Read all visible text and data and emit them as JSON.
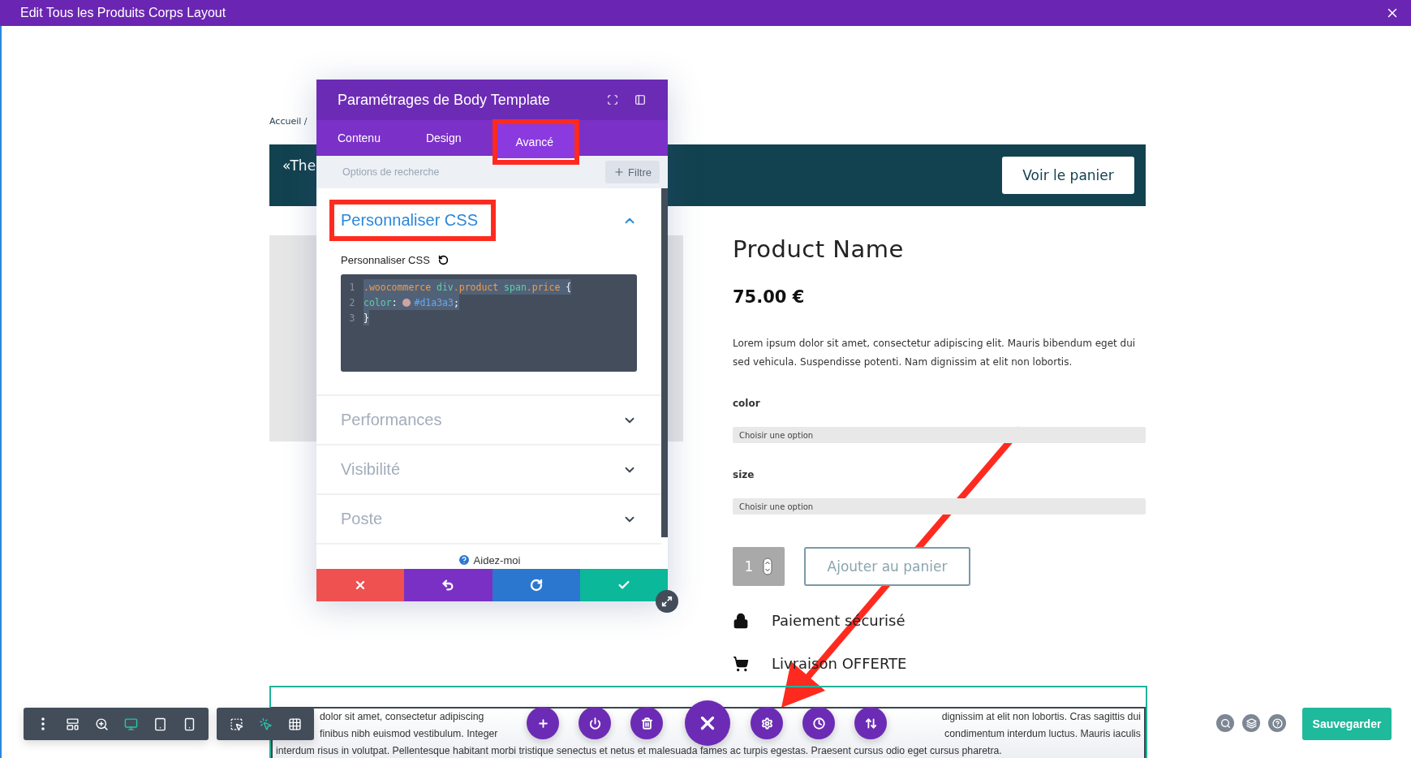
{
  "window": {
    "title": "Edit Tous les Produits Corps Layout"
  },
  "breadcrumb": "Accueil /",
  "banner": {
    "text": "«The",
    "button": "Voir le panier"
  },
  "product": {
    "name": "Product Name",
    "price": "75.00 €",
    "description": "Lorem ipsum dolor sit amet, consectetur adipiscing elit. Mauris bibendum eget dui sed vehicula. Suspendisse potenti. Nam dignissim at elit non lobortis.",
    "attributes": [
      {
        "label": "color",
        "placeholder": "Choisir une option"
      },
      {
        "label": "size",
        "placeholder": "Choisir une option"
      }
    ],
    "quantity": "1",
    "add_button": "Ajouter au panier",
    "features": [
      {
        "kind": "lock",
        "text": "Paiement sécurisé"
      },
      {
        "kind": "cart",
        "text": "Livraison OFFERTE"
      }
    ]
  },
  "description_lines": [
    {
      "segments": [
        "dolor sit amet, consectetur adipiscing",
        "dignissim at elit non lobortis. Cras sagittis dui"
      ]
    },
    {
      "segments": [
        "finibus nibh euismod vestibulum. Integer",
        "condimentum interdum luctus. Mauris iaculis"
      ]
    },
    {
      "segments": [
        "interdum risus in volutpat. Pellentesque habitant morbi tristique senectus et netus et malesuada fames ac turpis egestas. Praesent cursus odio eget cursus pharetra."
      ]
    }
  ],
  "modal": {
    "title": "Paramétrages de Body Template",
    "tabs": [
      {
        "label": "Contenu",
        "selected": false,
        "highlighted": false
      },
      {
        "label": "Design",
        "selected": false,
        "highlighted": false
      },
      {
        "label": "Avancé",
        "selected": true,
        "highlighted": true
      }
    ],
    "search_placeholder": "Options de recherche",
    "filter_button": "Filtre",
    "sections": [
      {
        "title": "Personnaliser CSS",
        "expanded": true,
        "highlighted": true,
        "field_label": "Personnaliser CSS",
        "code": [
          {
            "number": "1",
            "tokens": [
              {
                "kind": "selector",
                "text": ".woocommerce"
              },
              {
                "kind": "tag",
                "text": " div"
              },
              {
                "kind": "selector",
                "text": ".product"
              },
              {
                "kind": "tag",
                "text": " span"
              },
              {
                "kind": "selector",
                "text": ".price"
              },
              {
                "kind": "plain",
                "text": " {"
              }
            ]
          },
          {
            "number": "2",
            "tokens": [
              {
                "kind": "tag",
                "text": "color"
              },
              {
                "kind": "plain",
                "text": ": "
              },
              {
                "kind": "swatch",
                "color": "#d1a3a3"
              },
              {
                "kind": "value",
                "text": "#d1a3a3"
              },
              {
                "kind": "plain",
                "text": ";"
              }
            ]
          },
          {
            "number": "3",
            "tokens": [
              {
                "kind": "plain",
                "text": "}"
              }
            ]
          }
        ]
      },
      {
        "title": "Performances",
        "expanded": false,
        "highlighted": false
      },
      {
        "title": "Visibilité",
        "expanded": false,
        "highlighted": false
      },
      {
        "title": "Poste",
        "expanded": false,
        "highlighted": false
      }
    ],
    "help": "Aidez-moi",
    "actions": [
      {
        "kind": "cancel"
      },
      {
        "kind": "undo"
      },
      {
        "kind": "redo"
      },
      {
        "kind": "save"
      }
    ]
  },
  "toolbar": {
    "groups": [
      [
        {
          "kind": "menu",
          "selected": false
        },
        {
          "kind": "layout",
          "selected": false
        },
        {
          "kind": "zoom",
          "selected": false
        },
        {
          "kind": "desktop",
          "selected": true
        },
        {
          "kind": "tablet",
          "selected": false
        },
        {
          "kind": "phone",
          "selected": false
        }
      ],
      [
        {
          "kind": "select",
          "selected": false
        },
        {
          "kind": "click",
          "selected": true
        },
        {
          "kind": "grid",
          "selected": false
        }
      ]
    ]
  },
  "floating_actions": [
    {
      "kind": "add"
    },
    {
      "kind": "power"
    },
    {
      "kind": "delete"
    },
    {
      "kind": "close"
    },
    {
      "kind": "settings"
    },
    {
      "kind": "history"
    },
    {
      "kind": "sort"
    }
  ],
  "right_tools": [
    {
      "kind": "search"
    },
    {
      "kind": "layers"
    },
    {
      "kind": "help"
    }
  ],
  "save_button": "Sauvegarder"
}
